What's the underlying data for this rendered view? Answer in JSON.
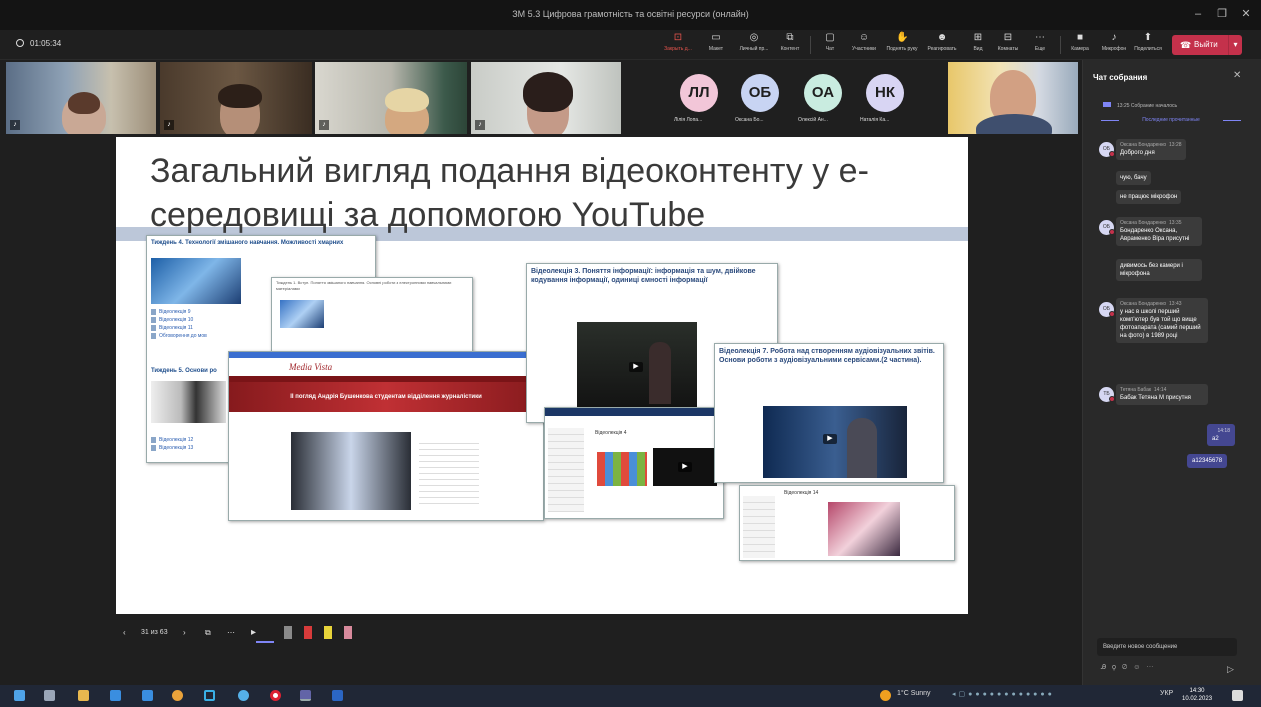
{
  "window": {
    "title": "ЗМ 5.3 Цифрова грамотність та освітні ресурси (онлайн)"
  },
  "toolbar": {
    "elapsed": "01:05:34",
    "buttons": [
      {
        "label": "Закрыть д...",
        "icon": "share-stop-icon"
      },
      {
        "label": "Макет",
        "icon": "layout-icon"
      },
      {
        "label": "Личный пр...",
        "icon": "view-icon"
      },
      {
        "label": "Контент",
        "icon": "content-icon"
      },
      {
        "label": "Чат",
        "icon": "chat-icon"
      },
      {
        "label": "Участники",
        "icon": "people-icon"
      },
      {
        "label": "Поднять руку",
        "icon": "hand-icon"
      },
      {
        "label": "Реагировать",
        "icon": "react-icon"
      },
      {
        "label": "Вид",
        "icon": "view-grid-icon"
      },
      {
        "label": "Комнаты",
        "icon": "rooms-icon"
      },
      {
        "label": "Еще",
        "icon": "more-icon"
      },
      {
        "label": "Камера",
        "icon": "camera-icon"
      },
      {
        "label": "Микрофон",
        "icon": "mic-icon"
      },
      {
        "label": "Поделиться",
        "icon": "share-icon"
      }
    ],
    "leave_label": "Выйти",
    "accent": "#c4314b"
  },
  "participants": [
    {
      "initials": "ЛЛ",
      "name": "Лілія Лопа...",
      "color": "#f2c6d8"
    },
    {
      "initials": "ОБ",
      "name": "Оксана Бо...",
      "color": "#c8d4f3"
    },
    {
      "initials": "ОА",
      "name": "Олексій Ан...",
      "color": "#c9ece0"
    },
    {
      "initials": "НК",
      "name": "Наталія Ка...",
      "color": "#d8d5f3"
    }
  ],
  "chat": {
    "title": "Чат собрания",
    "meeting_started": "13:25  Собрание началось",
    "last_read": "Последние прочитанные",
    "messages": [
      {
        "author": "Оксана Бондаренко",
        "time": "13:28",
        "initials": "ОБ",
        "lines": [
          "Доброго дня",
          "чую, бачу",
          "не працює мікрофон"
        ]
      },
      {
        "author": "Оксана Бондаренко",
        "time": "13:35",
        "initials": "ОБ",
        "lines": [
          "Бондаренко Оксана, Авраменко Віра присутні",
          "дивимось без камери і мікрофона"
        ]
      },
      {
        "author": "Оксана Бондаренко",
        "time": "13:43",
        "initials": "ОБ",
        "lines": [
          "у нас в школі перший комп'ютер був той що вище фотоапарата (самий перший на фото) в 1989 році"
        ]
      },
      {
        "author": "Тетяна Бабак",
        "time": "14:14",
        "initials": "ТБ",
        "lines": [
          "Бабак Тетяна М присутня"
        ]
      }
    ],
    "my_messages": [
      {
        "time": "14:18",
        "text": "а2"
      },
      {
        "time": "",
        "text": "а12345678"
      }
    ],
    "compose_placeholder": "Введите новое сообщение"
  },
  "slide": {
    "title": "Загальний вигляд подання відеоконтенту у е-середовищі за допомогою YouTube",
    "week4_header": "Тиждень 4. Технології змішаного навчання. Можливості хмарних",
    "week4_links": [
      "Відеолекція 9",
      "Відеолекція 10",
      "Відеолекція 11",
      "Обговорення до мов"
    ],
    "week5_header": "Тиждень 5. Основи ро",
    "week5_links": [
      "Відеолекція 12",
      "Відеолекція 13"
    ],
    "week1_header": "Тиждень 1. Вступ. Поняття змішаного навчання. Основні роботи з електронними навчальними матеріалами",
    "media_vista": "Media Vista",
    "media_vista_caption": "ІІ погляд Андрія Бушенкова студентам відділення журналістики",
    "lecture3": "Відеолекція 3. Поняття інформації: інформація та шум, двійкове кодування інформації, одиниці ємності інформації",
    "lecture7": "Відеолекція 7. Робота над створенням аудіовізуальних звітів. Основи роботи з аудіовізуальними сервісами.(2 частина).",
    "lecture_label": "Відеолекція 4",
    "lecture_label2": "Відеолекція 14"
  },
  "slide_nav": {
    "page": "31 из 63"
  },
  "taskbar": {
    "weather": "1°C  Sunny",
    "lang": "УКР",
    "time": "14:30",
    "date": "10.02.2023"
  }
}
